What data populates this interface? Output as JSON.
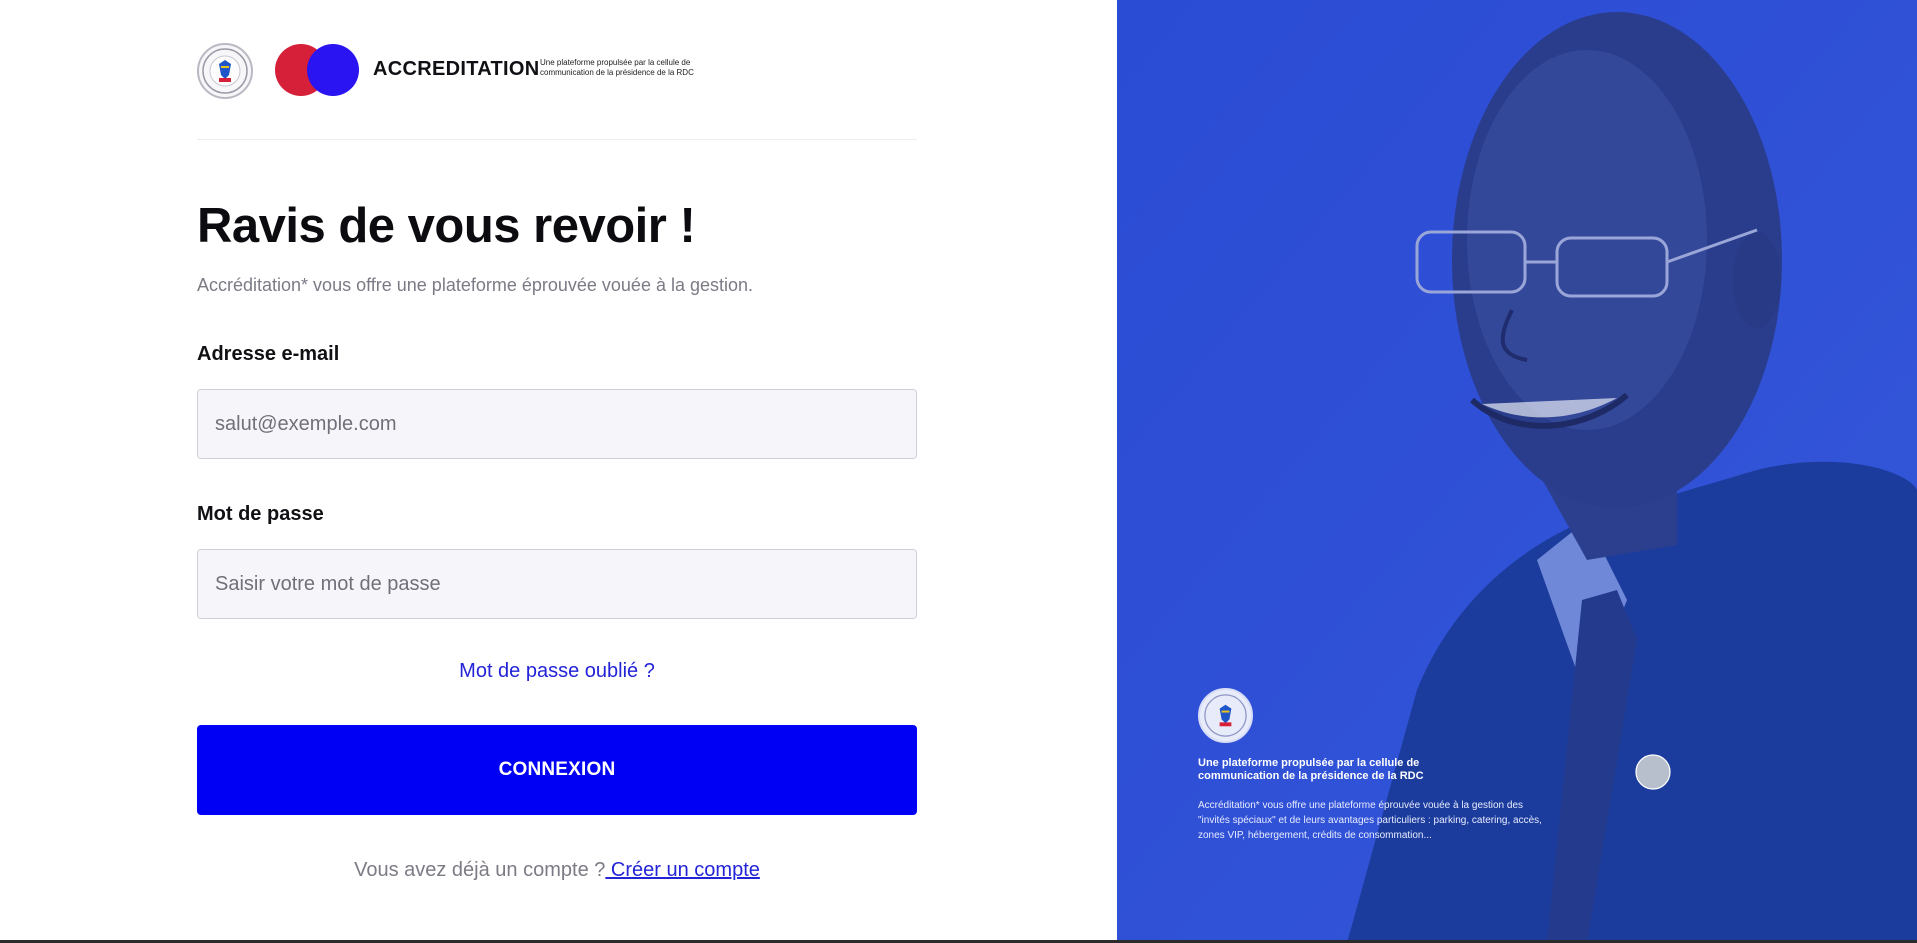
{
  "header": {
    "brand": "ACCREDITATION",
    "tagline": "Une plateforme propulsée par la cellule de communication de la présidence de la RDC"
  },
  "login": {
    "title": "Ravis de vous revoir !",
    "subtitle": "Accréditation* vous offre une plateforme éprouvée vouée à la gestion.",
    "email_label": "Adresse e-mail",
    "email_placeholder": "salut@exemple.com",
    "password_label": "Mot de passe",
    "password_placeholder": "Saisir votre mot de passe",
    "forgot": "Mot de passe oublié ?",
    "submit": "CONNEXION",
    "signup_prompt": "Vous avez déjà un compte ?",
    "signup_link": " Créer un compte"
  },
  "side": {
    "title": "Une plateforme propulsée par la cellule de communication de la présidence de la RDC",
    "description": "Accréditation* vous offre une plateforme éprouvée vouée à la gestion des \"invités spéciaux\" et de leurs avantages particuliers : parking, catering, accès, zones VIP, hébergement, crédits de consommation..."
  },
  "colors": {
    "accent": "#0000f5",
    "brand_red": "#d6203a",
    "brand_blue": "#2a14f2",
    "side_panel": "#2f4fd6"
  }
}
